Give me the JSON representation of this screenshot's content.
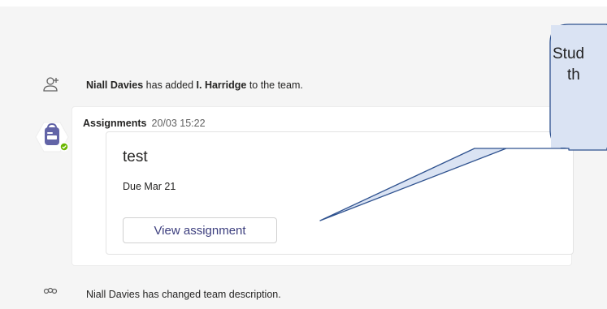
{
  "system_messages": [
    {
      "actor": "Niall Davies",
      "action": " has added ",
      "target": "I. Harridge",
      "suffix": " to the team."
    },
    {
      "text": "Niall Davies has changed team description."
    }
  ],
  "message": {
    "sender": "Assignments",
    "timestamp": "20/03 15:22",
    "avatar_icon": "backpack-icon",
    "status_color": "#6bb700",
    "card": {
      "title": "test",
      "due": "Due Mar 21",
      "button_label": "View assignment"
    }
  },
  "callout": {
    "line1": "Stud",
    "line2": "th",
    "fill": "#dae3f3",
    "stroke": "#2f528f"
  },
  "colors": {
    "assignments_purple": "#6264a7",
    "button_text": "#3c3e7e"
  }
}
